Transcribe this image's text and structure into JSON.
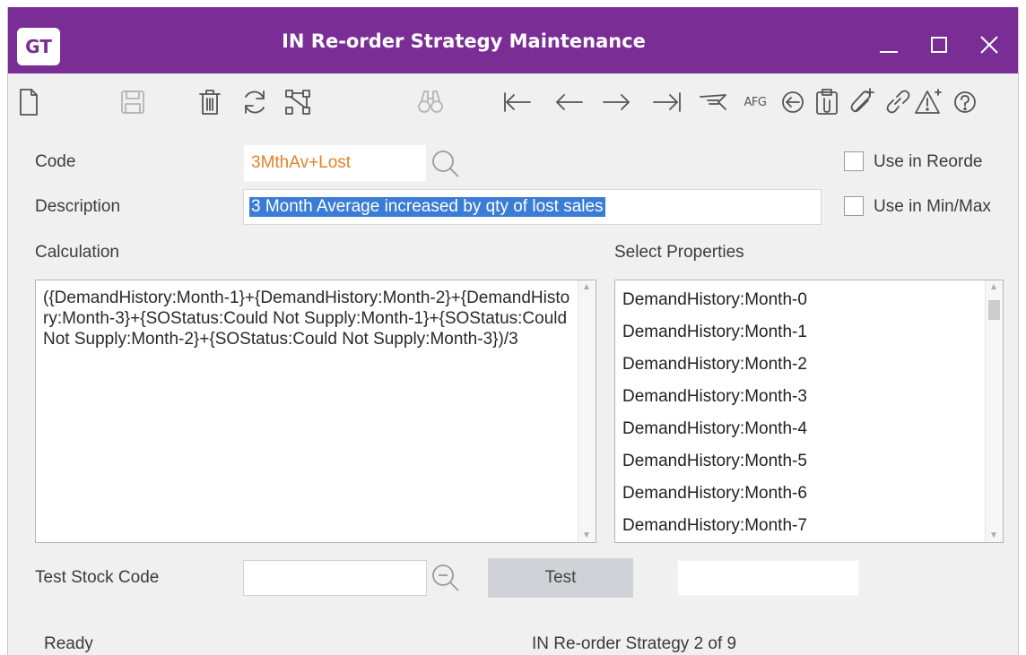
{
  "window": {
    "app_badge": "GT",
    "title": "IN Re-order Strategy Maintenance"
  },
  "toolbar": {
    "afg_label": "AFG",
    "icons": [
      "new-document-icon",
      "save-icon",
      "delete-icon",
      "refresh-icon",
      "hierarchy-icon",
      "find-icon",
      "first-record-icon",
      "previous-record-icon",
      "next-record-icon",
      "last-record-icon",
      "notes-icon",
      "afg-icon",
      "back-icon",
      "clipboard-icon",
      "attach-add-icon",
      "link-icon",
      "alert-icon",
      "help-icon"
    ]
  },
  "form": {
    "code_label": "Code",
    "code_value": "3MthAv+Lost",
    "description_label": "Description",
    "description_value": "3 Month Average increased by qty of lost sales",
    "use_in_reorder_label": "Use in Reorde",
    "use_in_minmax_label": "Use in Min/Max",
    "calculation_label": "Calculation",
    "calculation_value": "({DemandHistory:Month-1}+{DemandHistory:Month-2}+{DemandHistory:Month-3}+{SOStatus:Could Not Supply:Month-1}+{SOStatus:Could Not Supply:Month-2}+{SOStatus:Could Not Supply:Month-3})/3",
    "select_properties_label": "Select Properties",
    "properties": [
      "DemandHistory:Month-0",
      "DemandHistory:Month-1",
      "DemandHistory:Month-2",
      "DemandHistory:Month-3",
      "DemandHistory:Month-4",
      "DemandHistory:Month-5",
      "DemandHistory:Month-6",
      "DemandHistory:Month-7"
    ],
    "test_stock_code_label": "Test Stock Code",
    "test_stock_code_value": "",
    "test_button_label": "Test",
    "test_result_value": ""
  },
  "status": {
    "left": "Ready",
    "right": "IN Re-order Strategy 2 of 9"
  },
  "colors": {
    "titlebar": "#7a2e95",
    "code_text": "#e0822a",
    "selection": "#3b7cd6"
  }
}
